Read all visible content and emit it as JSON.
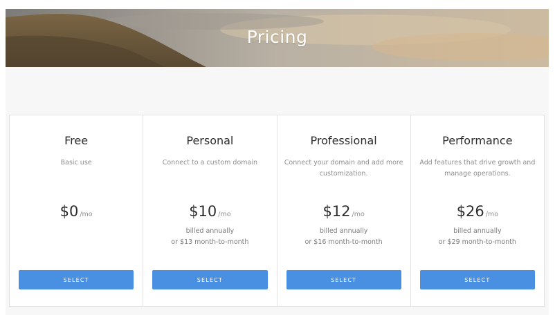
{
  "hero": {
    "title": "Pricing"
  },
  "plans": [
    {
      "name": "Free",
      "description": "Basic use",
      "price": "$0",
      "per": "/mo",
      "billing_line1": "",
      "billing_line2": "",
      "button_label": "SELECT"
    },
    {
      "name": "Personal",
      "description": "Connect to a custom domain",
      "price": "$10",
      "per": "/mo",
      "billing_line1": "billed annually",
      "billing_line2": "or $13 month-to-month",
      "button_label": "SELECT"
    },
    {
      "name": "Professional",
      "description": "Connect your domain and add more customization.",
      "price": "$12",
      "per": "/mo",
      "billing_line1": "billed annually",
      "billing_line2": "or $16 month-to-month",
      "button_label": "SELECT"
    },
    {
      "name": "Performance",
      "description": "Add features that drive growth and manage operations.",
      "price": "$26",
      "per": "/mo",
      "billing_line1": "billed annually",
      "billing_line2": "or $29 month-to-month",
      "button_label": "SELECT"
    }
  ],
  "colors": {
    "accent": "#4a90e2",
    "background_band": "#f7f7f7",
    "border": "#e1e1e1",
    "heading_text": "#2d2d2d",
    "muted_text": "#8e8e8e"
  }
}
